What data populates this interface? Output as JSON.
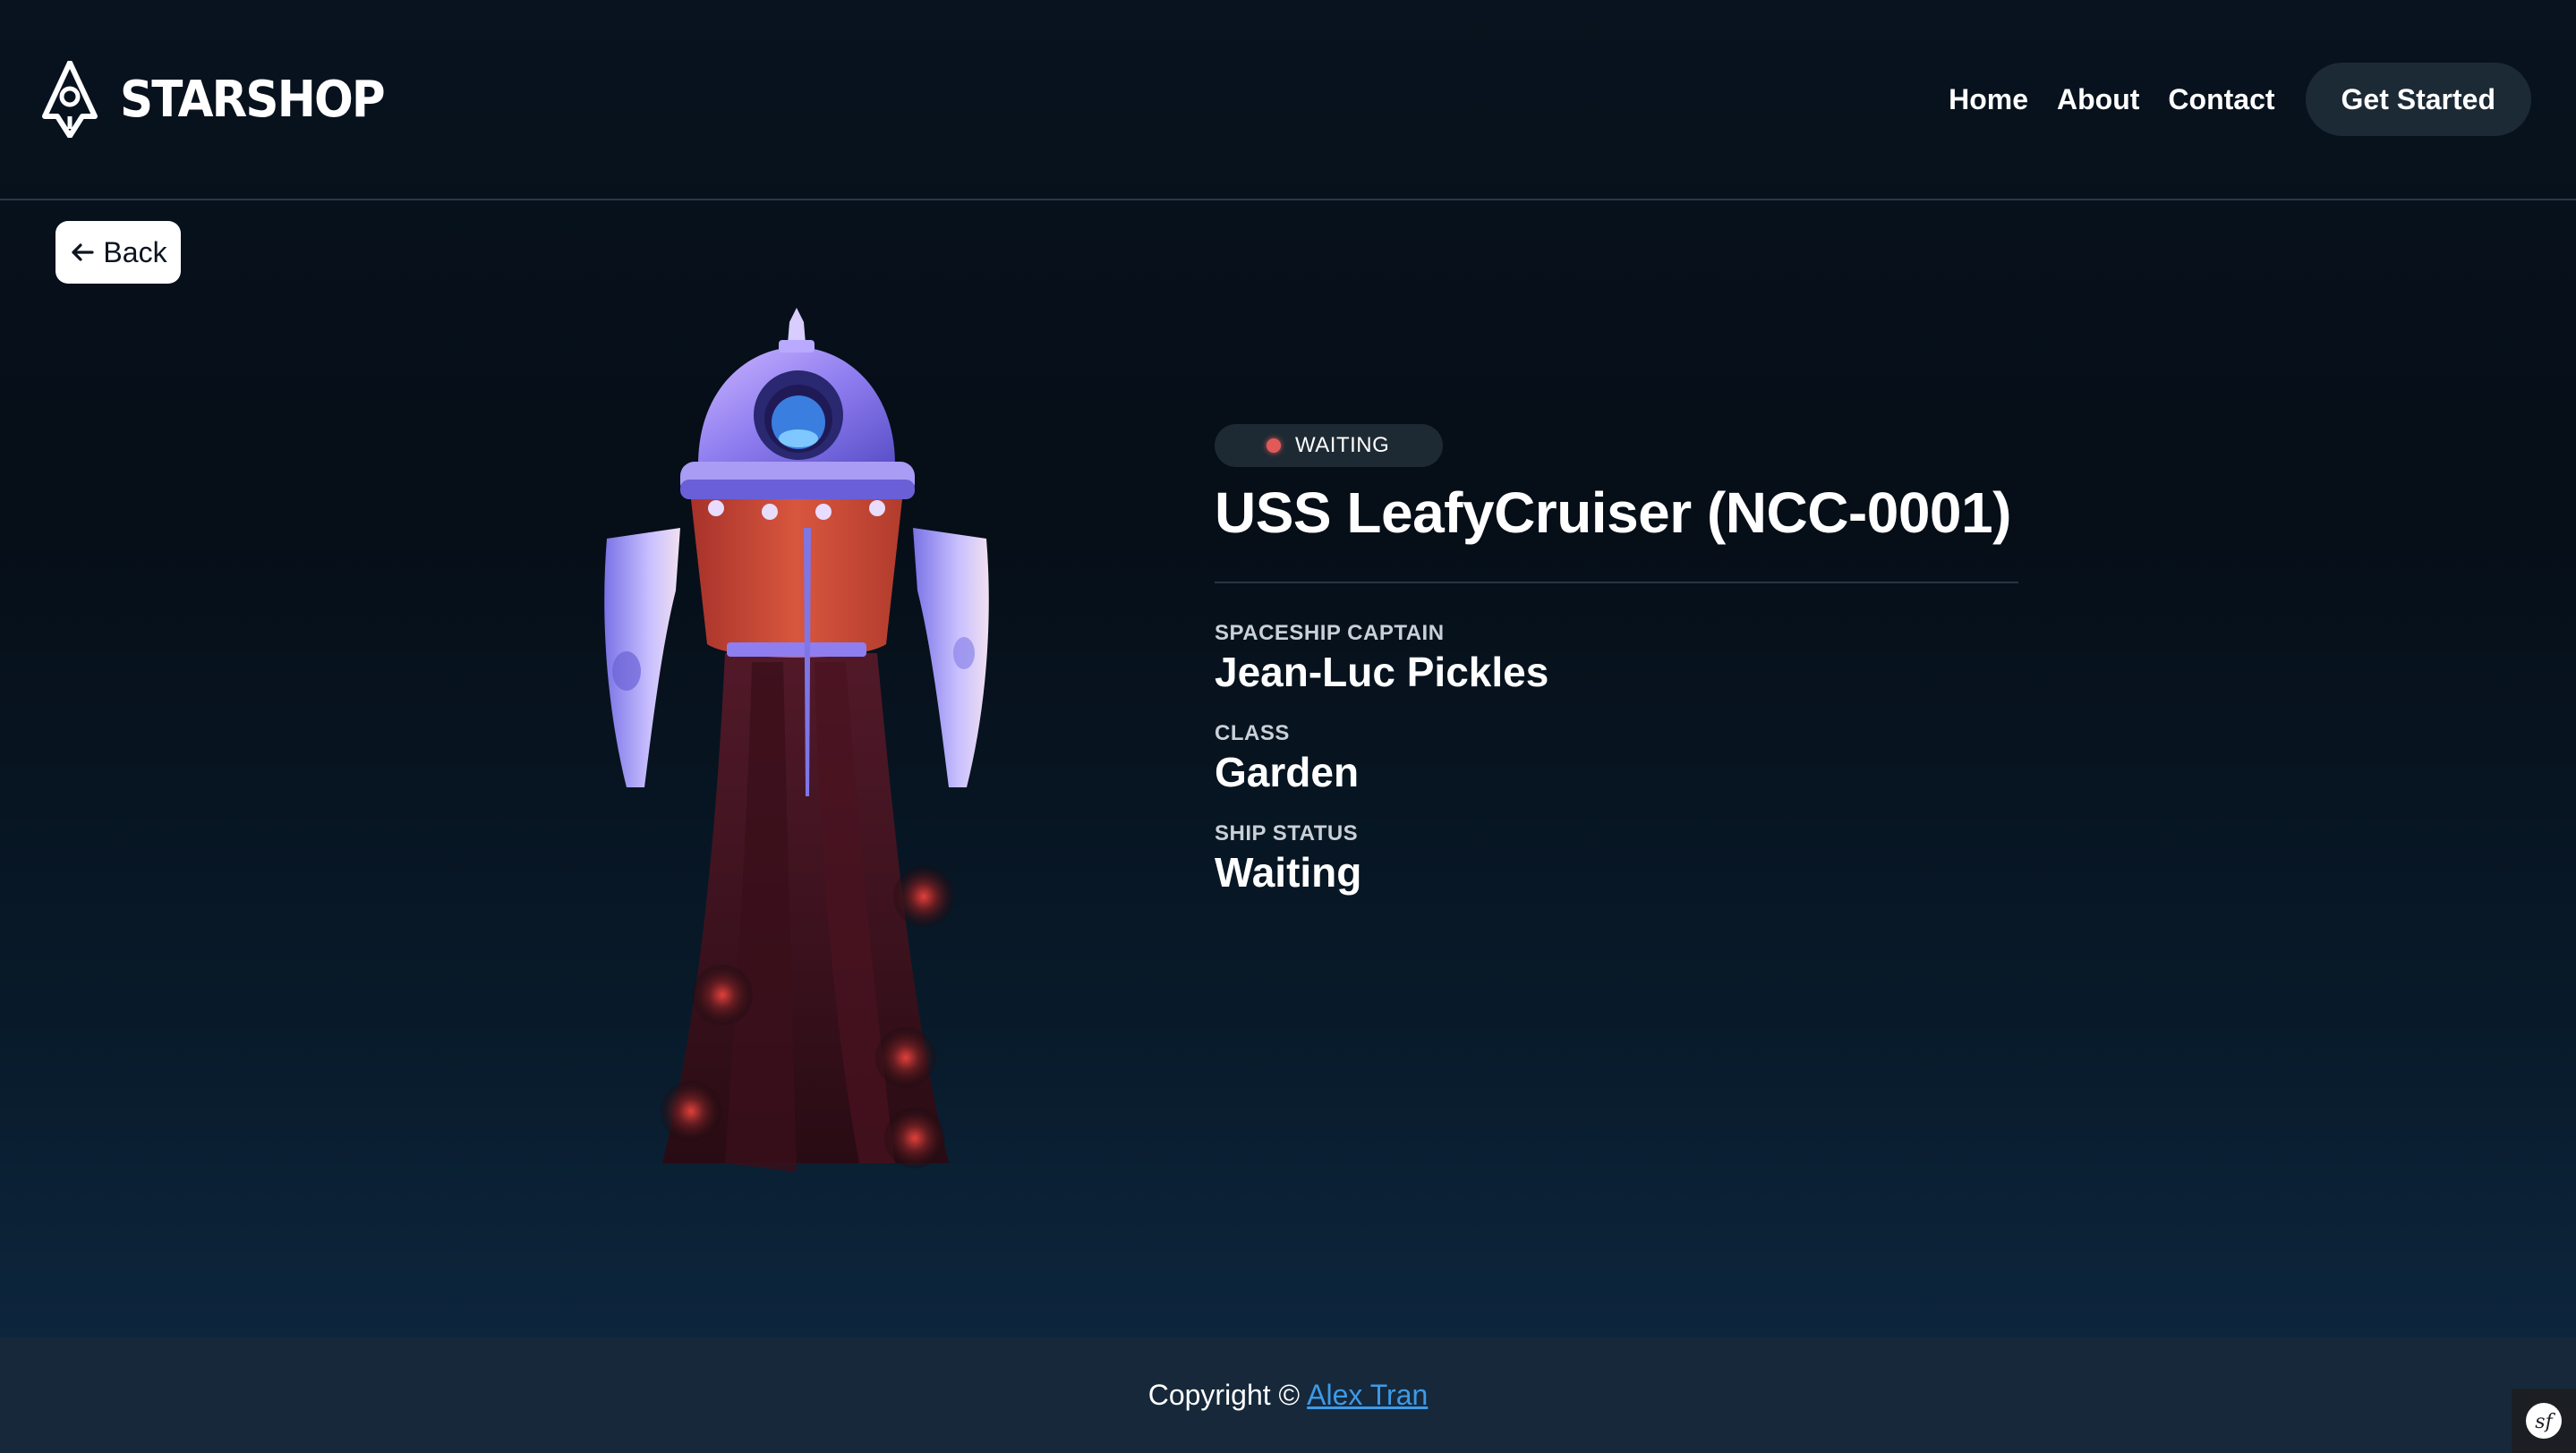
{
  "brand": {
    "name": "STARSHOP"
  },
  "nav": {
    "home": "Home",
    "about": "About",
    "contact": "Contact",
    "cta": "Get Started"
  },
  "back": {
    "label": "Back"
  },
  "ship": {
    "status_badge": "WAITING",
    "name": "USS LeafyCruiser (NCC-0001)",
    "fields": {
      "captain_label": "SPACESHIP CAPTAIN",
      "captain_value": "Jean-Luc Pickles",
      "class_label": "CLASS",
      "class_value": "Garden",
      "status_label": "SHIP STATUS",
      "status_value": "Waiting"
    },
    "status_color": "#e05a5a"
  },
  "footer": {
    "copyright": "Copyright ©",
    "author": "Alex Tran",
    "author_color": "#3d9ae8"
  },
  "icons": {
    "logo": "rocket-logo-icon",
    "back": "arrow-left-icon",
    "debug": "symfony-icon"
  }
}
